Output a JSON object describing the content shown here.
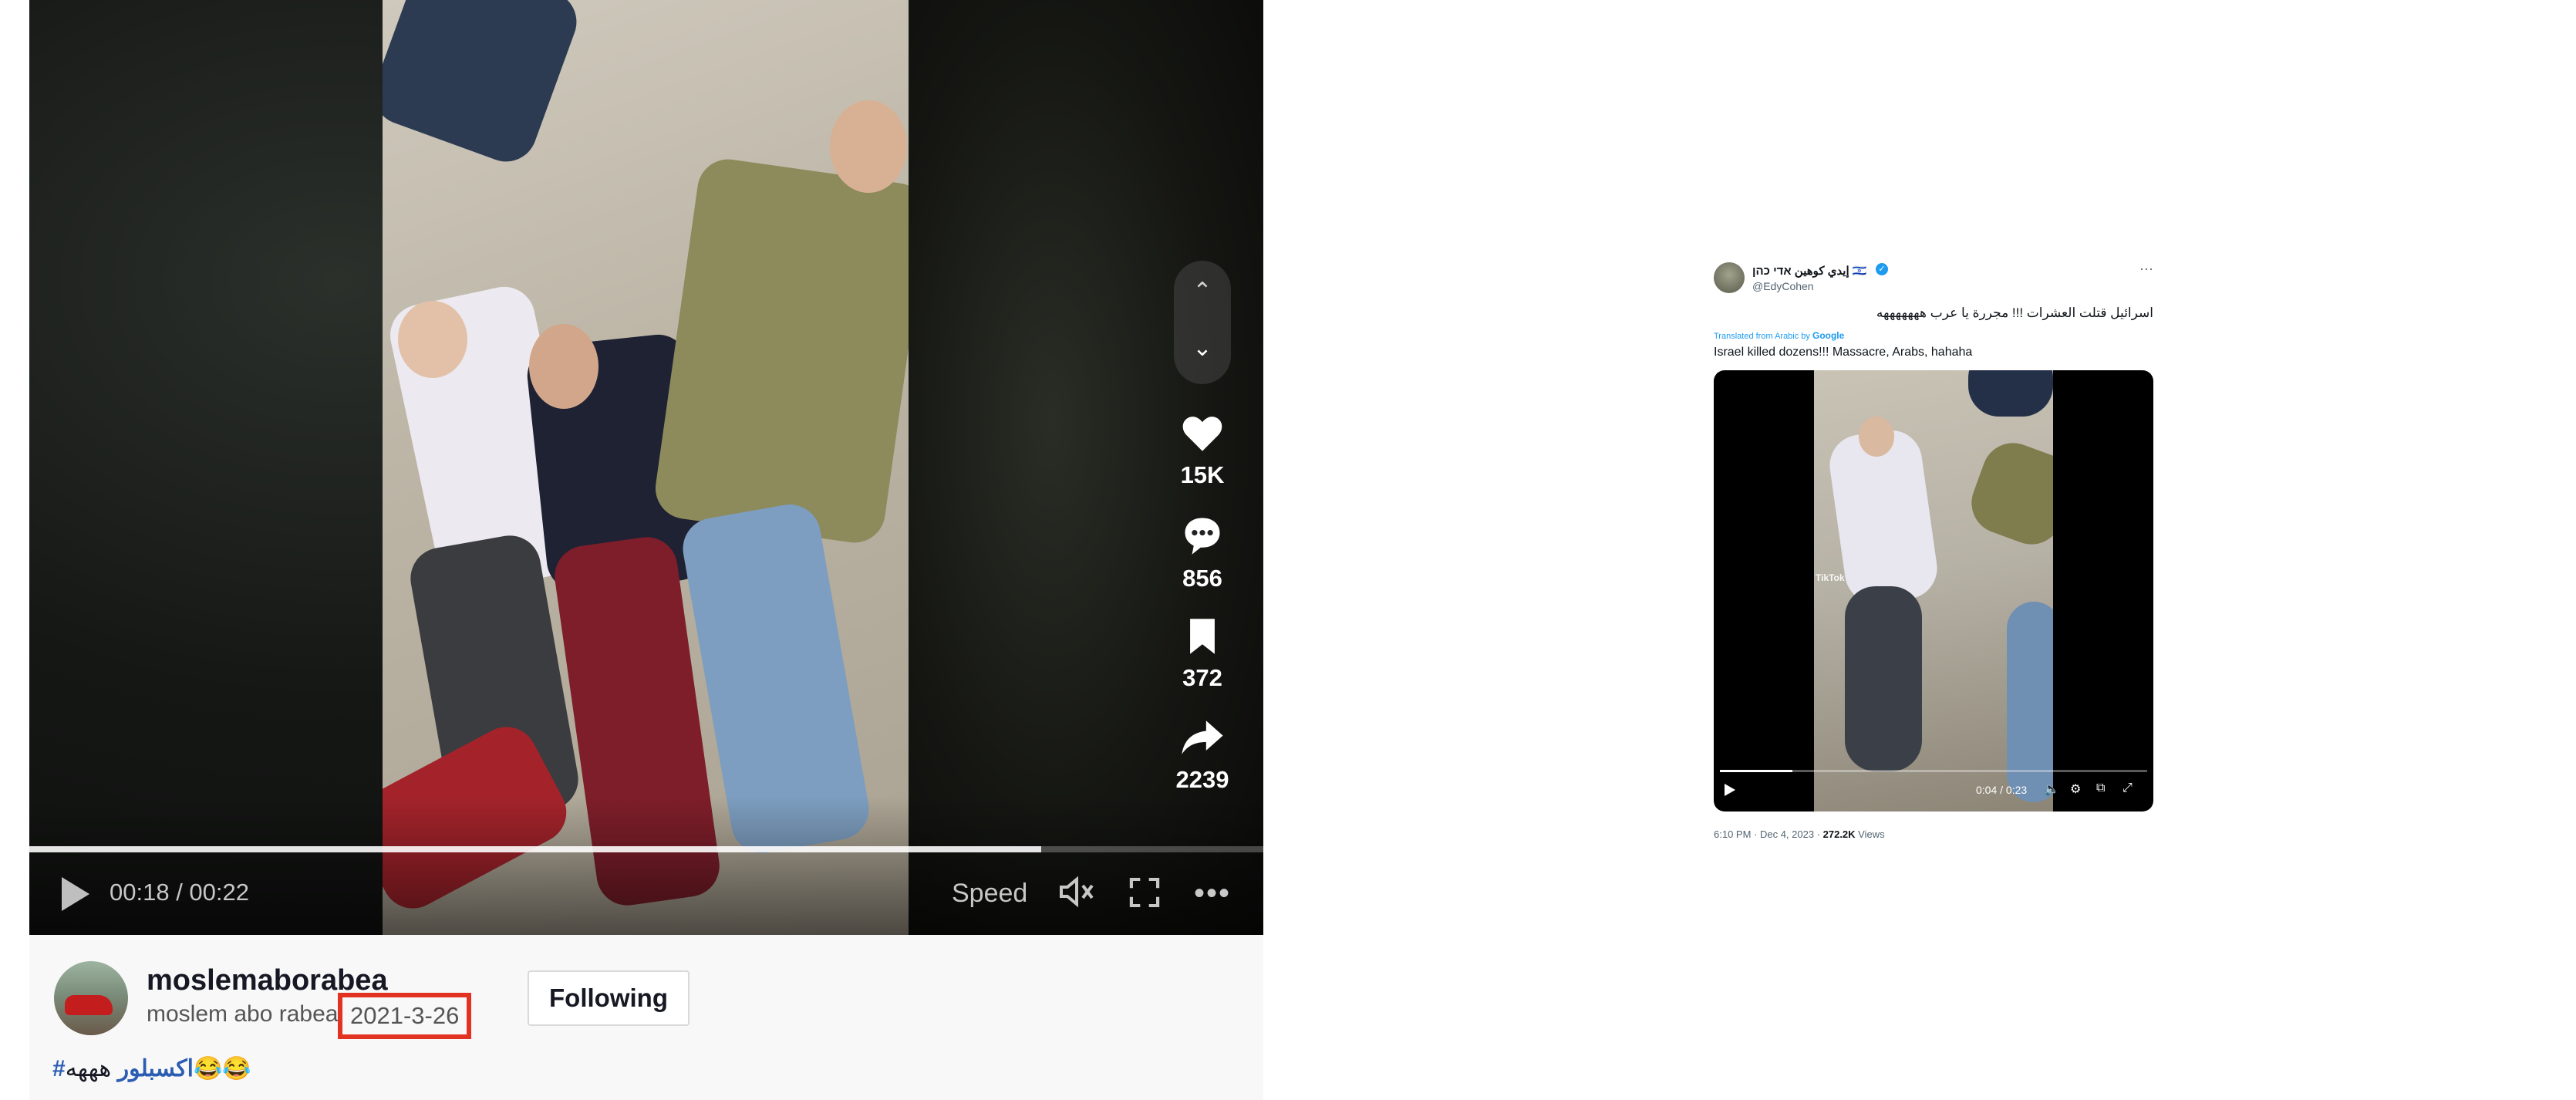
{
  "tiktok": {
    "player": {
      "current_time": "00:18",
      "duration": "00:22",
      "progress_fraction": 0.82,
      "speed_label": "Speed",
      "icons": [
        "play-icon",
        "volume-icon",
        "fullscreen-icon",
        "more-icon",
        "chevron-up-icon",
        "chevron-down-icon"
      ]
    },
    "actions": {
      "likes": "15K",
      "comments": "856",
      "saves": "372",
      "shares": "2239"
    },
    "author": {
      "username": "moslemaborabea",
      "nickname": "moslem abo rabea",
      "date": "2021-3-26",
      "follow_label": "Following"
    },
    "caption": {
      "hashtag": "#اكسبلور",
      "text": "هههه😂😂"
    },
    "colors": {
      "highlight_box": "#e23322",
      "hashtag": "#2b5db3"
    }
  },
  "tweet": {
    "display_name": "إيدي كوهين אדי כהן 🇮🇱",
    "handle": "@EdyCohen",
    "text_arabic": "اسرائيل قتلت العشرات !!! مجررة يا عرب هههههههه",
    "translated_label": "Translated from Arabic by",
    "translator": "Google",
    "text_english": "Israel killed dozens!!! Massacre, Arabs, hahaha",
    "video": {
      "current_time": "0:04",
      "duration": "0:23",
      "progress_fraction": 0.17,
      "watermark": "TikTok"
    },
    "footer": {
      "time": "6:10 PM · Dec 4, 2023 · ",
      "views_count": "272.2K",
      "views_label": " Views"
    },
    "colors": {
      "verified": "#1d9bf0",
      "link": "#1d9bf0"
    }
  }
}
